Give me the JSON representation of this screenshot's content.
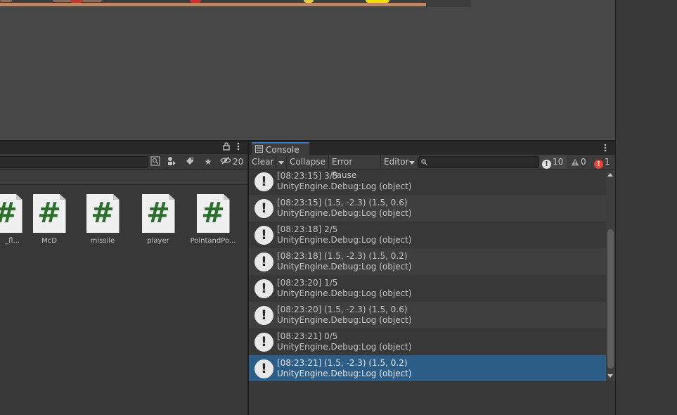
{
  "project": {
    "hidden_count": "20",
    "assets": [
      {
        "name": "_fl..."
      },
      {
        "name": "McD"
      },
      {
        "name": "missile"
      },
      {
        "name": "player"
      },
      {
        "name": "PointandPo..."
      }
    ],
    "icons": {
      "lock": "lock-icon",
      "menu": "kebab-menu-icon",
      "search_by_type": "search-type-icon",
      "label": "label-icon",
      "favorite": "star-icon",
      "hidden": "eye-slash-icon"
    }
  },
  "console": {
    "tab_label": "Console",
    "toolbar": {
      "clear": "Clear",
      "collapse": "Collapse",
      "error_pause": "Error Pause",
      "editor": "Editor",
      "search_placeholder": ""
    },
    "counts": {
      "info": "10",
      "warning": "0",
      "error": "1"
    },
    "logs": [
      {
        "line1": "[08:23:15] 3/5",
        "line2": "UnityEngine.Debug:Log (object)"
      },
      {
        "line1": "[08:23:15] (1.5, -2.3) (1.5, 0.6)",
        "line2": "UnityEngine.Debug:Log (object)"
      },
      {
        "line1": "[08:23:18] 2/5",
        "line2": "UnityEngine.Debug:Log (object)"
      },
      {
        "line1": "[08:23:18] (1.5, -2.3) (1.5, 0.2)",
        "line2": "UnityEngine.Debug:Log (object)"
      },
      {
        "line1": "[08:23:20] 1/5",
        "line2": "UnityEngine.Debug:Log (object)"
      },
      {
        "line1": "[08:23:20] (1.5, -2.3) (1.5, 0.6)",
        "line2": "UnityEngine.Debug:Log (object)"
      },
      {
        "line1": "[08:23:21] 0/5",
        "line2": "UnityEngine.Debug:Log (object)"
      },
      {
        "line1": "[08:23:21] (1.5, -2.3) (1.5, 0.2)",
        "line2": "UnityEngine.Debug:Log (object)"
      }
    ],
    "selected_index": 7,
    "colors": {
      "selection": "#2c5d87",
      "error_badge": "#e0443a",
      "tab_accent": "#3a79bb"
    }
  }
}
